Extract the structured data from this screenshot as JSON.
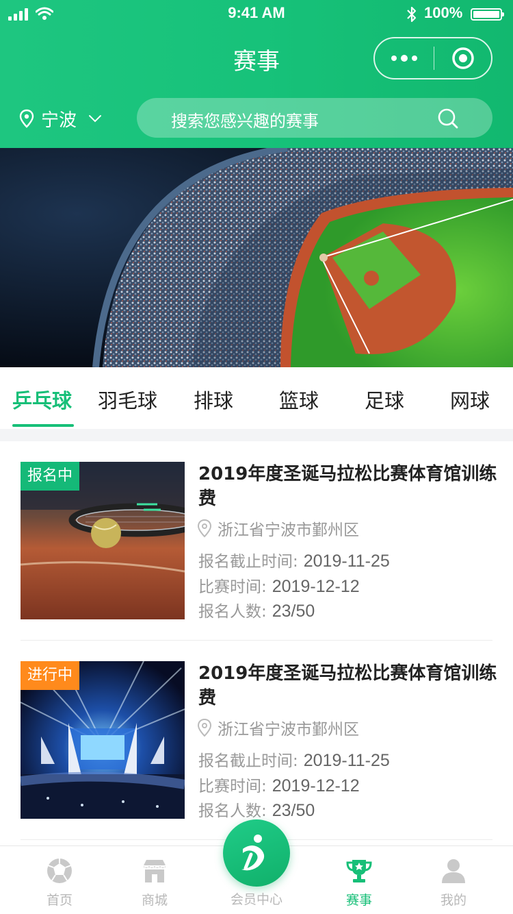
{
  "status_bar": {
    "time": "9:41 AM",
    "battery": "100%"
  },
  "nav": {
    "title": "赛事"
  },
  "location": {
    "city": "宁波"
  },
  "search": {
    "placeholder": "搜索您感兴趣的赛事"
  },
  "tabs": [
    {
      "label": "乒乓球",
      "active": true
    },
    {
      "label": "羽毛球"
    },
    {
      "label": "排球"
    },
    {
      "label": "篮球"
    },
    {
      "label": "足球"
    },
    {
      "label": "网球"
    }
  ],
  "events": [
    {
      "status": "报名中",
      "title": "2019年度圣诞马拉松比赛体育馆训练费",
      "location": "浙江省宁波市鄞州区",
      "deadline_label": "报名截止时间:",
      "deadline": "2019-11-25",
      "match_time_label": "比赛时间:",
      "match_time": "2019-12-12",
      "count_label": "报名人数:",
      "count": "23/50"
    },
    {
      "status": "进行中",
      "title": "2019年度圣诞马拉松比赛体育馆训练费",
      "location": "浙江省宁波市鄞州区",
      "deadline_label": "报名截止时间:",
      "deadline": "2019-11-25",
      "match_time_label": "比赛时间:",
      "match_time": "2019-12-12",
      "count_label": "报名人数:",
      "count": "23/50"
    }
  ],
  "tabbar": [
    {
      "label": "首页",
      "icon": "ball-icon"
    },
    {
      "label": "商城",
      "icon": "store-icon"
    },
    {
      "label": "会员中心",
      "icon": "member-logo-icon"
    },
    {
      "label": "赛事",
      "icon": "trophy-icon",
      "active": true
    },
    {
      "label": "我的",
      "icon": "user-icon"
    }
  ],
  "colors": {
    "brand": "#17bf78",
    "badge_signup": "#15b978",
    "badge_ongoing": "#ff8a1c"
  }
}
